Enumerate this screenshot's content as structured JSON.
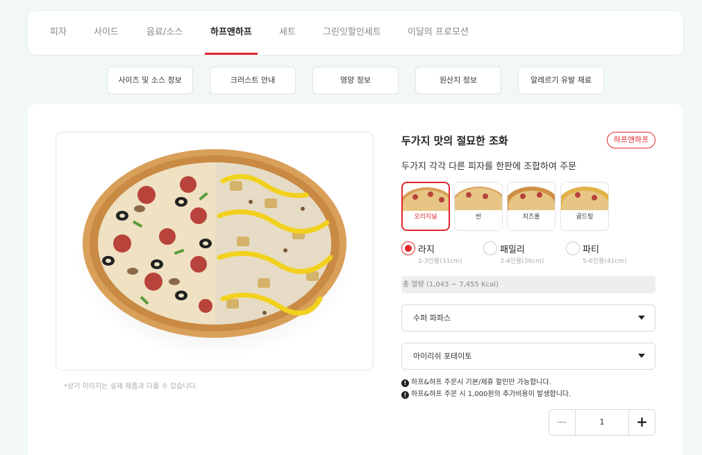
{
  "tabs": [
    {
      "label": "피자"
    },
    {
      "label": "사이드"
    },
    {
      "label": "음료/소스"
    },
    {
      "label": "하프앤하프"
    },
    {
      "label": "세트"
    },
    {
      "label": "그린잇할인세트"
    },
    {
      "label": "이달의 프로모션"
    }
  ],
  "active_tab": "하프앤하프",
  "info_buttons": [
    {
      "label": "사이즈 및 소스 정보"
    },
    {
      "label": "크러스트 안내"
    },
    {
      "label": "영양 정보"
    },
    {
      "label": "원산지 정보"
    },
    {
      "label": "알레르기 유발 재료"
    }
  ],
  "product": {
    "title": "두가지 맛의 절묘한 조화",
    "badge": "하프앤하프",
    "subtitle": "두가지 각각 다른 피자를 한판에 조합하여 주문",
    "image_note": "*상기 이미지는 실제 제품과 다를 수 있습니다."
  },
  "crusts": [
    {
      "label": "오리지널",
      "selected": true
    },
    {
      "label": "씬",
      "selected": false
    },
    {
      "label": "치즈롤",
      "selected": false
    },
    {
      "label": "골드링",
      "selected": false
    }
  ],
  "sizes": [
    {
      "label": "라지",
      "sub": "2-3인용(31cm)",
      "selected": true
    },
    {
      "label": "패밀리",
      "sub": "3-4인용(36cm)",
      "selected": false
    },
    {
      "label": "파티",
      "sub": "5-6인용(41cm)",
      "selected": false
    }
  ],
  "kcal": "총 열량 (1,043 ~ 7,455 Kcal)",
  "select1": {
    "value": "수퍼 파파스"
  },
  "select2": {
    "value": "아이리쉬 포테이토"
  },
  "notices": [
    {
      "text": "하프&하프 주문시 기본/제휴 할인만 가능합니다."
    },
    {
      "text": "하프&하프 주문 시 1,000원의 추가비용이 발생합니다."
    }
  ],
  "quantity": {
    "value": "1",
    "minus": "−",
    "plus": "+"
  },
  "colors": {
    "accent": "#e0262b",
    "background": "#f2f7f7"
  },
  "icons": {
    "notice": "info-circle-icon",
    "dropdown": "caret-down-icon"
  }
}
